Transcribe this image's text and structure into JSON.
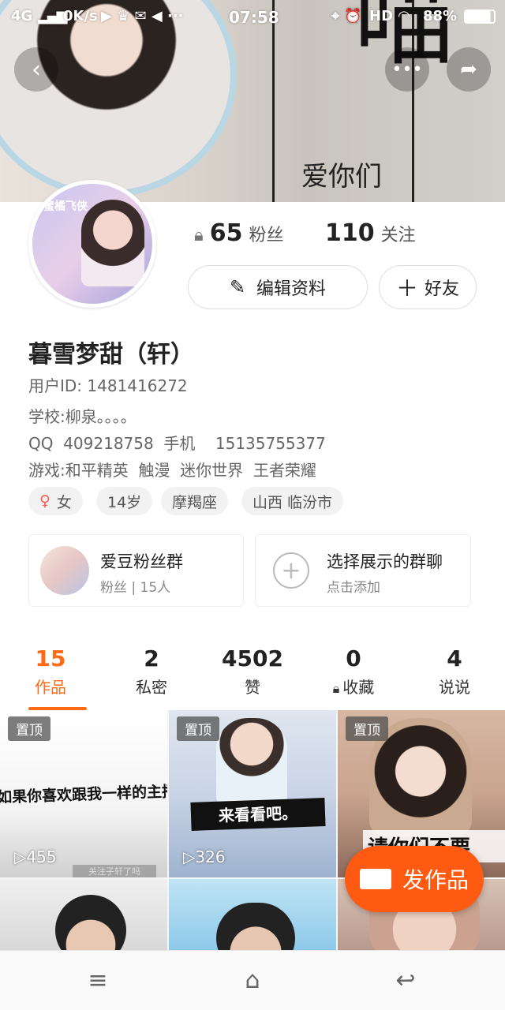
{
  "status_bar": {
    "network": "4G",
    "speed": "0K/s",
    "time": "07:58",
    "hd": "HD",
    "battery": "88%"
  },
  "banner": {
    "big_char": "喵",
    "caption": "爱你们"
  },
  "avatar": {
    "badge_text": "蜜橘飞侠"
  },
  "stats": {
    "fans_count": "65",
    "fans_label": "粉丝",
    "follow_count": "110",
    "follow_label": "关注"
  },
  "actions": {
    "edit_label": "编辑资料",
    "friend_label": "好友"
  },
  "profile": {
    "name": "暮雪梦甜（轩）",
    "user_id": "用户ID: 1481416272",
    "school": "学校:柳泉。。。。",
    "contact": "QQ  409218758  手机    15135755377",
    "games": "游戏:和平精英  触漫  迷你世界  王者荣耀"
  },
  "tags": [
    {
      "label": "女"
    },
    {
      "label": "14岁"
    },
    {
      "label": "摩羯座"
    },
    {
      "label": "山西 临汾市"
    }
  ],
  "groups": {
    "fan_group_title": "爱豆粉丝群",
    "fan_group_sub": "粉丝 | 15人",
    "select_title": "选择展示的群聊",
    "select_sub": "点击添加"
  },
  "tabs": [
    {
      "num": "15",
      "label": "作品"
    },
    {
      "num": "2",
      "label": "私密"
    },
    {
      "num": "4502",
      "label": "赞"
    },
    {
      "num": "0",
      "label": "收藏"
    },
    {
      "num": "4",
      "label": "说说"
    }
  ],
  "grid": {
    "pin_label": "置顶",
    "tile1_text": "如果你喜欢跟我一样的主播",
    "tile1_views": "455",
    "tile1_sub": "关注子轩了吗",
    "tile2_text": "来看看吧。",
    "tile2_views": "326",
    "tile3_text": "请你们不要"
  },
  "fab": {
    "label": "发作品"
  },
  "colors": {
    "accent": "#ff6a14",
    "fab": "#ff5a12"
  },
  "icons": [
    "back-arrow-icon",
    "share-icon",
    "more-icon",
    "lock-icon",
    "edit-icon",
    "plus-icon",
    "female-icon",
    "add-circle-icon",
    "play-icon",
    "video-camera-icon",
    "menu-icon",
    "home-icon",
    "return-icon"
  ]
}
